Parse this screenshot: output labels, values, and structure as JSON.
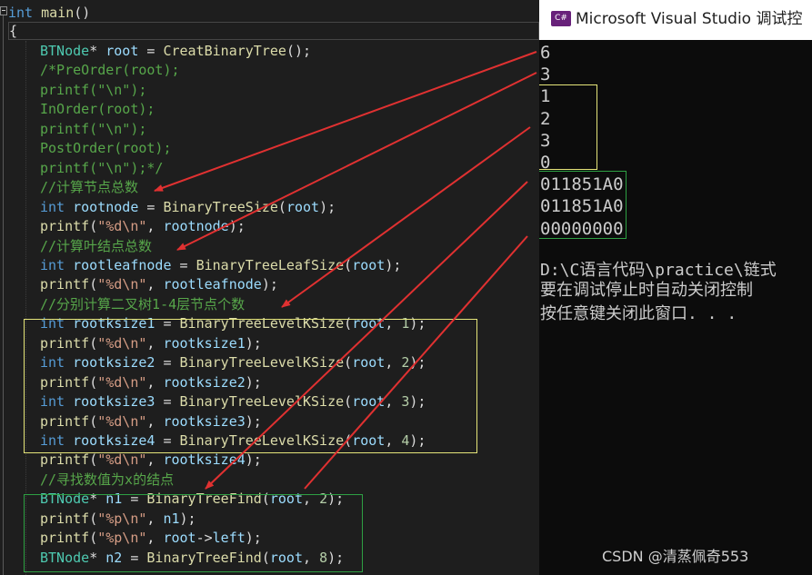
{
  "editor": {
    "header": {
      "kw": "int",
      "fn": "main",
      "rest": "()"
    },
    "open_brace": "{",
    "lines": [
      {
        "parts": [
          [
            "ty",
            "BTNode"
          ],
          [
            "pl",
            "* "
          ],
          [
            "var",
            "root"
          ],
          [
            "pl",
            " = "
          ],
          [
            "fn",
            "CreatBinaryTree"
          ],
          [
            "pl",
            "();"
          ]
        ]
      },
      {
        "parts": [
          [
            "cm",
            "/*PreOrder(root);"
          ]
        ]
      },
      {
        "parts": [
          [
            "cm",
            "printf(\"\\n\");"
          ]
        ]
      },
      {
        "parts": [
          [
            "cm",
            "InOrder(root);"
          ]
        ]
      },
      {
        "parts": [
          [
            "cm",
            "printf(\"\\n\");"
          ]
        ]
      },
      {
        "parts": [
          [
            "cm",
            "PostOrder(root);"
          ]
        ]
      },
      {
        "parts": [
          [
            "cm",
            "printf(\"\\n\");*/"
          ]
        ]
      },
      {
        "parts": [
          [
            "cm",
            "//计算节点总数"
          ]
        ]
      },
      {
        "parts": [
          [
            "kw",
            "int"
          ],
          [
            "pl",
            " "
          ],
          [
            "var",
            "rootnode"
          ],
          [
            "pl",
            " = "
          ],
          [
            "fn",
            "BinaryTreeSize"
          ],
          [
            "pl",
            "("
          ],
          [
            "var",
            "root"
          ],
          [
            "pl",
            ");"
          ]
        ]
      },
      {
        "parts": [
          [
            "fn",
            "printf"
          ],
          [
            "pl",
            "("
          ],
          [
            "str",
            "\"%d\\n\""
          ],
          [
            "pl",
            ", "
          ],
          [
            "var",
            "rootnode"
          ],
          [
            "pl",
            ");"
          ]
        ]
      },
      {
        "parts": [
          [
            "cm",
            "//计算叶结点总数"
          ]
        ]
      },
      {
        "parts": [
          [
            "kw",
            "int"
          ],
          [
            "pl",
            " "
          ],
          [
            "var",
            "rootleafnode"
          ],
          [
            "pl",
            " = "
          ],
          [
            "fn",
            "BinaryTreeLeafSize"
          ],
          [
            "pl",
            "("
          ],
          [
            "var",
            "root"
          ],
          [
            "pl",
            ");"
          ]
        ]
      },
      {
        "parts": [
          [
            "fn",
            "printf"
          ],
          [
            "pl",
            "("
          ],
          [
            "str",
            "\"%d\\n\""
          ],
          [
            "pl",
            ", "
          ],
          [
            "var",
            "rootleafnode"
          ],
          [
            "pl",
            ");"
          ]
        ]
      },
      {
        "parts": [
          [
            "cm",
            "//分别计算二叉树1-4层节点个数"
          ]
        ]
      },
      {
        "parts": [
          [
            "kw",
            "int"
          ],
          [
            "pl",
            " "
          ],
          [
            "var",
            "rootksize1"
          ],
          [
            "pl",
            " = "
          ],
          [
            "fn",
            "BinaryTreeLevelKSize"
          ],
          [
            "pl",
            "("
          ],
          [
            "var",
            "root"
          ],
          [
            "pl",
            ", "
          ],
          [
            "num",
            "1"
          ],
          [
            "pl",
            ");"
          ]
        ]
      },
      {
        "parts": [
          [
            "fn",
            "printf"
          ],
          [
            "pl",
            "("
          ],
          [
            "str",
            "\"%d\\n\""
          ],
          [
            "pl",
            ", "
          ],
          [
            "var",
            "rootksize1"
          ],
          [
            "pl",
            ");"
          ]
        ]
      },
      {
        "parts": [
          [
            "kw",
            "int"
          ],
          [
            "pl",
            " "
          ],
          [
            "var",
            "rootksize2"
          ],
          [
            "pl",
            " = "
          ],
          [
            "fn",
            "BinaryTreeLevelKSize"
          ],
          [
            "pl",
            "("
          ],
          [
            "var",
            "root"
          ],
          [
            "pl",
            ", "
          ],
          [
            "num",
            "2"
          ],
          [
            "pl",
            ");"
          ]
        ]
      },
      {
        "parts": [
          [
            "fn",
            "printf"
          ],
          [
            "pl",
            "("
          ],
          [
            "str",
            "\"%d\\n\""
          ],
          [
            "pl",
            ", "
          ],
          [
            "var",
            "rootksize2"
          ],
          [
            "pl",
            ");"
          ]
        ]
      },
      {
        "parts": [
          [
            "kw",
            "int"
          ],
          [
            "pl",
            " "
          ],
          [
            "var",
            "rootksize3"
          ],
          [
            "pl",
            " = "
          ],
          [
            "fn",
            "BinaryTreeLevelKSize"
          ],
          [
            "pl",
            "("
          ],
          [
            "var",
            "root"
          ],
          [
            "pl",
            ", "
          ],
          [
            "num",
            "3"
          ],
          [
            "pl",
            ");"
          ]
        ]
      },
      {
        "parts": [
          [
            "fn",
            "printf"
          ],
          [
            "pl",
            "("
          ],
          [
            "str",
            "\"%d\\n\""
          ],
          [
            "pl",
            ", "
          ],
          [
            "var",
            "rootksize3"
          ],
          [
            "pl",
            ");"
          ]
        ]
      },
      {
        "parts": [
          [
            "kw",
            "int"
          ],
          [
            "pl",
            " "
          ],
          [
            "var",
            "rootksize4"
          ],
          [
            "pl",
            " = "
          ],
          [
            "fn",
            "BinaryTreeLevelKSize"
          ],
          [
            "pl",
            "("
          ],
          [
            "var",
            "root"
          ],
          [
            "pl",
            ", "
          ],
          [
            "num",
            "4"
          ],
          [
            "pl",
            ");"
          ]
        ]
      },
      {
        "parts": [
          [
            "fn",
            "printf"
          ],
          [
            "pl",
            "("
          ],
          [
            "str",
            "\"%d\\n\""
          ],
          [
            "pl",
            ", "
          ],
          [
            "var",
            "rootksize4"
          ],
          [
            "pl",
            ");"
          ]
        ]
      },
      {
        "parts": [
          [
            "cm",
            "//寻找数值为x的结点"
          ]
        ]
      },
      {
        "parts": [
          [
            "ty",
            "BTNode"
          ],
          [
            "pl",
            "* "
          ],
          [
            "var",
            "n1"
          ],
          [
            "pl",
            " = "
          ],
          [
            "fn",
            "BinaryTreeFind"
          ],
          [
            "pl",
            "("
          ],
          [
            "var",
            "root"
          ],
          [
            "pl",
            ", "
          ],
          [
            "num",
            "2"
          ],
          [
            "pl",
            ");"
          ]
        ]
      },
      {
        "parts": [
          [
            "fn",
            "printf"
          ],
          [
            "pl",
            "("
          ],
          [
            "str",
            "\"%p\\n\""
          ],
          [
            "pl",
            ", "
          ],
          [
            "var",
            "n1"
          ],
          [
            "pl",
            ");"
          ]
        ]
      },
      {
        "parts": [
          [
            "fn",
            "printf"
          ],
          [
            "pl",
            "("
          ],
          [
            "str",
            "\"%p\\n\""
          ],
          [
            "pl",
            ", "
          ],
          [
            "var",
            "root"
          ],
          [
            "pl",
            "->"
          ],
          [
            "var",
            "left"
          ],
          [
            "pl",
            ");"
          ]
        ]
      },
      {
        "parts": [
          [
            "ty",
            "BTNode"
          ],
          [
            "pl",
            "* "
          ],
          [
            "var",
            "n2"
          ],
          [
            "pl",
            " = "
          ],
          [
            "fn",
            "BinaryTreeFind"
          ],
          [
            "pl",
            "("
          ],
          [
            "var",
            "root"
          ],
          [
            "pl",
            ", "
          ],
          [
            "num",
            "8"
          ],
          [
            "pl",
            ");"
          ]
        ]
      }
    ]
  },
  "console": {
    "title": "Microsoft Visual Studio 调试控",
    "icon_label": "C#",
    "output": [
      "6",
      "3",
      "1",
      "2",
      "3",
      "0",
      "011851A0",
      "011851A0",
      "00000000"
    ],
    "messages": [
      "D:\\C语言代码\\practice\\链式",
      "要在调试停止时自动关闭控制",
      "按任意键关闭此窗口. . ."
    ]
  },
  "watermark": "CSDN @清蒸佩奇553",
  "colors": {
    "editor_bg": "#1e1e1e",
    "console_bg": "#0c0c0c",
    "arrow": "#e03131",
    "highlight_yellow": "#e6e67a",
    "highlight_green": "#2ea043"
  }
}
